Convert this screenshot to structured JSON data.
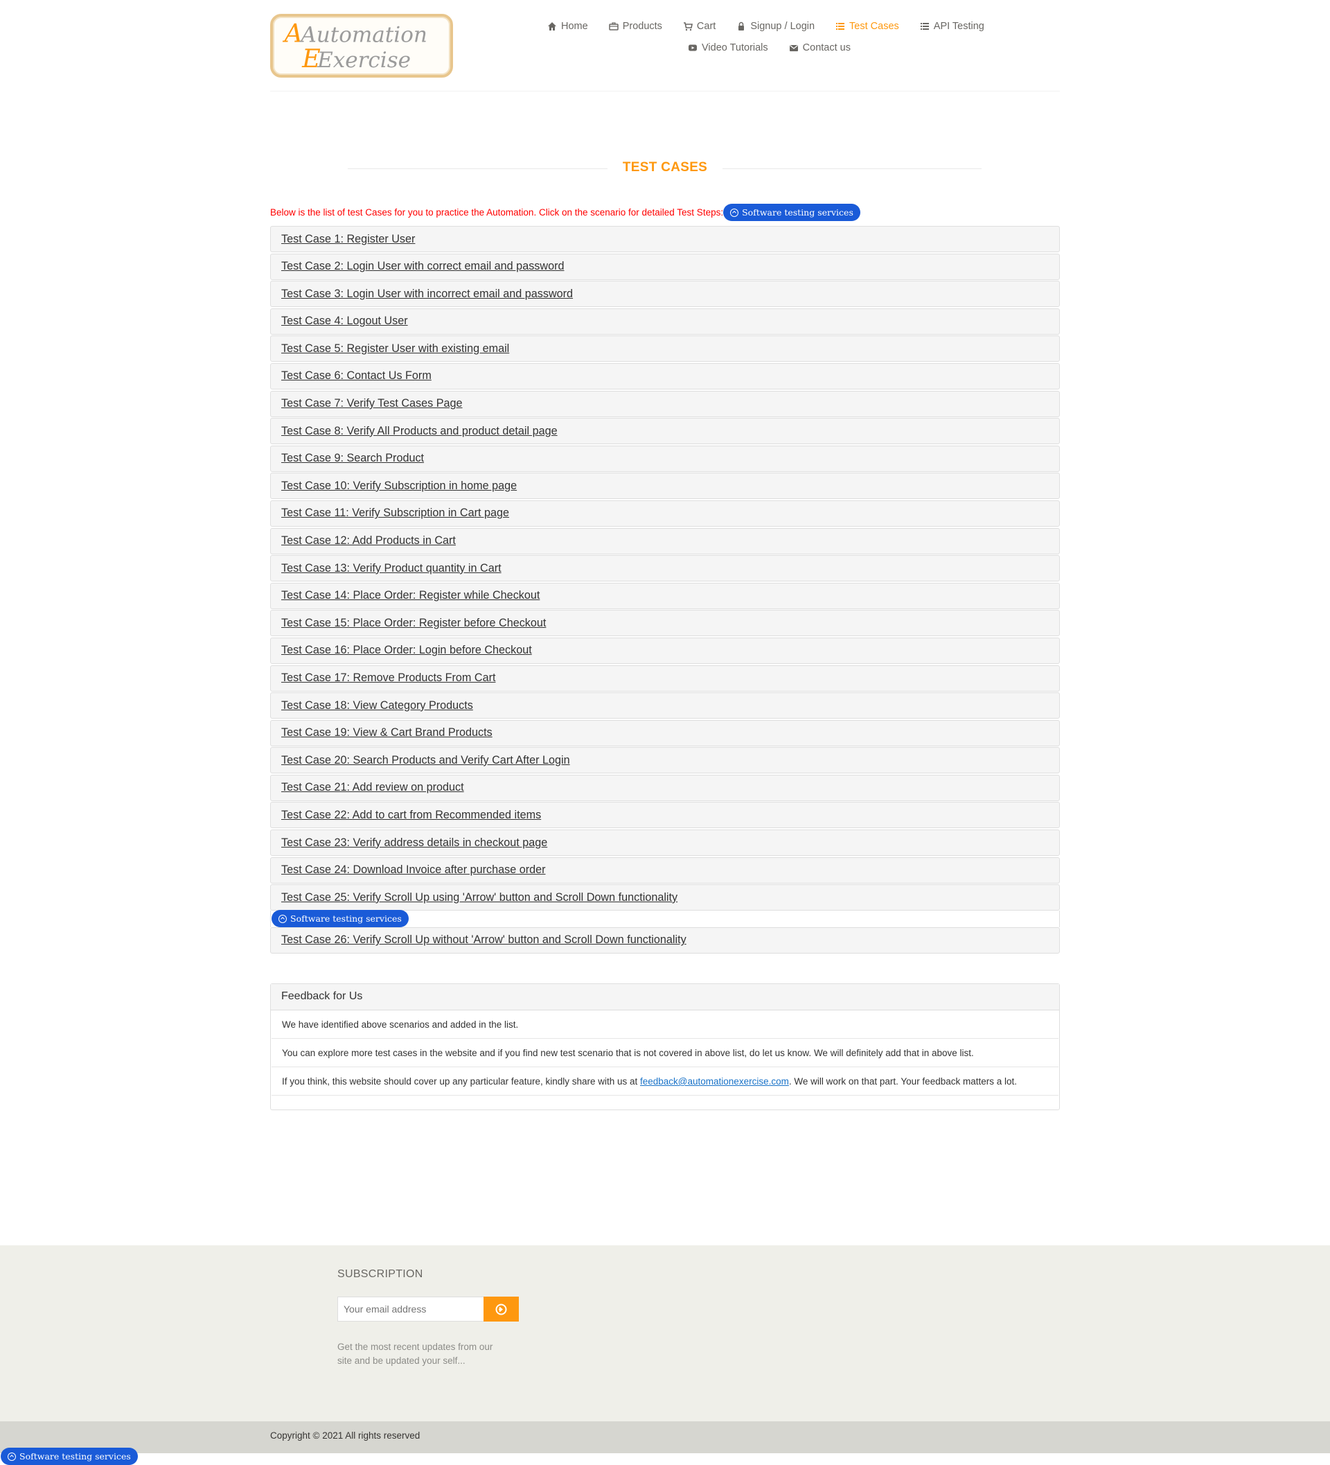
{
  "logo": {
    "line1": "Automation",
    "line2": "Exercise"
  },
  "nav": [
    {
      "label": "Home",
      "icon": "home-icon"
    },
    {
      "label": "Products",
      "icon": "briefcase-icon"
    },
    {
      "label": "Cart",
      "icon": "cart-icon"
    },
    {
      "label": "Signup / Login",
      "icon": "lock-icon"
    },
    {
      "label": "Test Cases",
      "icon": "list-icon",
      "active": true
    },
    {
      "label": "API Testing",
      "icon": "list-icon"
    },
    {
      "label": "Video Tutorials",
      "icon": "youtube-icon"
    },
    {
      "label": "Contact us",
      "icon": "envelope-icon"
    }
  ],
  "page_title": "TEST CASES",
  "intro": "Below is the list of test Cases for you to practice the Automation. Click on the scenario for detailed Test Steps:",
  "ad_badge": "Software testing services",
  "test_cases": [
    "Test Case 1: Register User",
    "Test Case 2: Login User with correct email and password",
    "Test Case 3: Login User with incorrect email and password",
    "Test Case 4: Logout User",
    "Test Case 5: Register User with existing email",
    "Test Case 6: Contact Us Form",
    "Test Case 7: Verify Test Cases Page",
    "Test Case 8: Verify All Products and product detail page",
    "Test Case 9: Search Product",
    "Test Case 10: Verify Subscription in home page",
    "Test Case 11: Verify Subscription in Cart page",
    "Test Case 12: Add Products in Cart",
    "Test Case 13: Verify Product quantity in Cart",
    "Test Case 14: Place Order: Register while Checkout",
    "Test Case 15: Place Order: Register before Checkout",
    "Test Case 16: Place Order: Login before Checkout",
    "Test Case 17: Remove Products From Cart",
    "Test Case 18: View Category Products",
    "Test Case 19: View & Cart Brand Products",
    "Test Case 20: Search Products and Verify Cart After Login",
    "Test Case 21: Add review on product",
    "Test Case 22: Add to cart from Recommended items",
    "Test Case 23: Verify address details in checkout page",
    "Test Case 24: Download Invoice after purchase order",
    "Test Case 25: Verify Scroll Up using 'Arrow' button and Scroll Down functionality",
    "Test Case 26: Verify Scroll Up without 'Arrow' button and Scroll Down functionality"
  ],
  "feedback": {
    "heading": "Feedback for Us",
    "line1": "We have identified above scenarios and added in the list.",
    "line2": "You can explore more test cases in the website and if you find new test scenario that is not covered in above list, do let us know. We will definitely add that in above list.",
    "line3_before": "If you think, this website should cover up any particular feature, kindly share with us at ",
    "line3_email": "feedback@automationexercise.com",
    "line3_after": ". We will work on that part. Your feedback matters a lot."
  },
  "subscription": {
    "title": "SUBSCRIPTION",
    "placeholder": "Your email address",
    "text": "Get the most recent updates from our site and be updated your self..."
  },
  "copyright": "Copyright © 2021 All rights reserved",
  "colors": {
    "accent": "#FE980F",
    "badge": "#1A5BD8",
    "intro": "#FF0000",
    "footer_bg": "#EFEFE9"
  }
}
